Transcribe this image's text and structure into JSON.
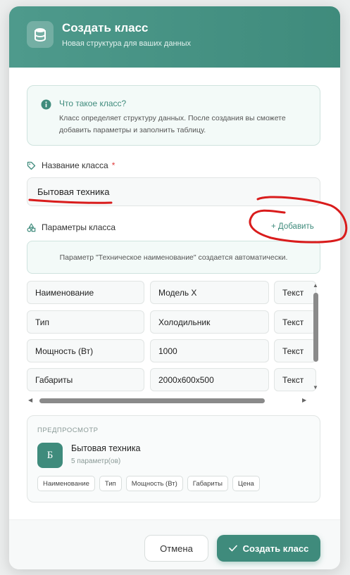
{
  "header": {
    "icon": "database-icon",
    "title": "Создать класс",
    "subtitle": "Новая структура для ваших данных"
  },
  "info": {
    "icon": "info-icon",
    "title": "Что такое класс?",
    "text": "Класс определяет структуру данных. После создания вы сможете добавить параметры и заполнить таблицу."
  },
  "class_name": {
    "icon": "tag-icon",
    "label": "Название класса",
    "required_mark": "*",
    "value": "Бытовая техника"
  },
  "params": {
    "icon": "shapes-icon",
    "label": "Параметры класса",
    "add_label": "+ Добавить",
    "notice": "Параметр \"Техническое наименование\" создается автоматически.",
    "rows": [
      {
        "name": "Наименование",
        "value": "Модель X",
        "type": "Текст"
      },
      {
        "name": "Тип",
        "value": "Холодильник",
        "type": "Текст"
      },
      {
        "name": "Мощность (Вт)",
        "value": "1000",
        "type": "Текст"
      },
      {
        "name": "Габариты",
        "value": "2000x600x500",
        "type": "Текст"
      }
    ]
  },
  "preview": {
    "label": "ПРЕДПРОСМОТР",
    "avatar_letter": "Б",
    "name": "Бытовая техника",
    "count": "5 параметр(ов)",
    "tags": [
      "Наименование",
      "Тип",
      "Мощность (Вт)",
      "Габариты",
      "Цена"
    ]
  },
  "footer": {
    "cancel_label": "Отмена",
    "create_label": "Создать класс"
  },
  "colors": {
    "accent": "#3f8b7c",
    "annotation": "#d91c1c"
  }
}
